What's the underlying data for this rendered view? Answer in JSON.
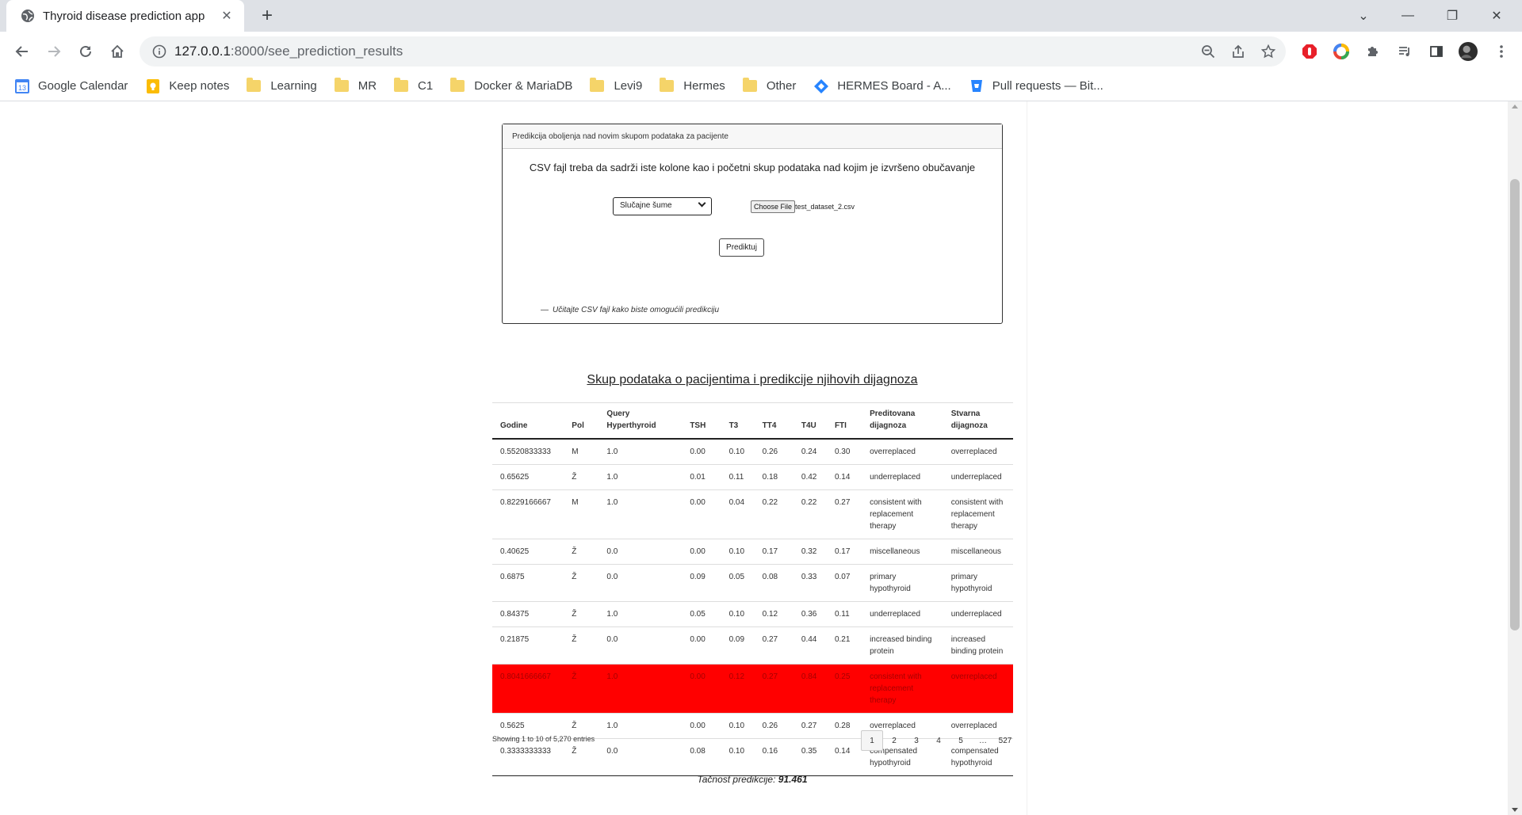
{
  "browser": {
    "tab_title": "Thyroid disease prediction app",
    "url_host": "127.0.0.1",
    "url_path": ":8000/see_prediction_results",
    "bookmarks": [
      {
        "label": "Google Calendar",
        "icon": "calendar-icon"
      },
      {
        "label": "Keep notes",
        "icon": "keep-icon"
      },
      {
        "label": "Learning",
        "icon": "folder-icon"
      },
      {
        "label": "MR",
        "icon": "folder-icon"
      },
      {
        "label": "C1",
        "icon": "folder-icon"
      },
      {
        "label": "Docker & MariaDB",
        "icon": "folder-icon"
      },
      {
        "label": "Levi9",
        "icon": "folder-icon"
      },
      {
        "label": "Hermes",
        "icon": "folder-icon"
      },
      {
        "label": "Other",
        "icon": "folder-icon"
      },
      {
        "label": "HERMES Board - A...",
        "icon": "diamond-icon"
      },
      {
        "label": "Pull requests — Bit...",
        "icon": "shield-icon"
      }
    ]
  },
  "upload_card": {
    "header": "Predikcija obolјenja nad novim skupom podataka za pacijente",
    "description": "CSV fajl treba da sadrži iste kolone kao i početni skup podataka nad kojim je izvršeno obučavanje",
    "model_select": "Slučajne šume",
    "file_button": "Choose File",
    "file_name": "test_dataset_2.csv",
    "predict_button": "Prediktuj",
    "hint_dash": "—",
    "hint": "Učitajte CSV fajl kako biste omogućili predikciju"
  },
  "results": {
    "title": "Skup podataka o pacijentima i predikcije njihovih dijagnoza",
    "columns": [
      "Godine",
      "Pol",
      "Query Hyperthyroid",
      "TSH",
      "T3",
      "TT4",
      "T4U",
      "FTI",
      "Preditovana dijagnoza",
      "Stvarna dijagnoza"
    ],
    "rows": [
      {
        "godine": "0.5520833333",
        "pol": "M",
        "query": "1.0",
        "tsh": "0.00",
        "t3": "0.10",
        "tt4": "0.26",
        "t4u": "0.24",
        "fti": "0.30",
        "pred": "overreplaced",
        "actual": "overreplaced",
        "mismatch": false
      },
      {
        "godine": "0.65625",
        "pol": "Ž",
        "query": "1.0",
        "tsh": "0.01",
        "t3": "0.11",
        "tt4": "0.18",
        "t4u": "0.42",
        "fti": "0.14",
        "pred": "underreplaced",
        "actual": "underreplaced",
        "mismatch": false
      },
      {
        "godine": "0.8229166667",
        "pol": "M",
        "query": "1.0",
        "tsh": "0.00",
        "t3": "0.04",
        "tt4": "0.22",
        "t4u": "0.22",
        "fti": "0.27",
        "pred": "consistent with replacement therapy",
        "actual": "consistent with replacement therapy",
        "mismatch": false
      },
      {
        "godine": "0.40625",
        "pol": "Ž",
        "query": "0.0",
        "tsh": "0.00",
        "t3": "0.10",
        "tt4": "0.17",
        "t4u": "0.32",
        "fti": "0.17",
        "pred": "miscellaneous",
        "actual": "miscellaneous",
        "mismatch": false
      },
      {
        "godine": "0.6875",
        "pol": "Ž",
        "query": "0.0",
        "tsh": "0.09",
        "t3": "0.05",
        "tt4": "0.08",
        "t4u": "0.33",
        "fti": "0.07",
        "pred": "primary hypothyroid",
        "actual": "primary hypothyroid",
        "mismatch": false
      },
      {
        "godine": "0.84375",
        "pol": "Ž",
        "query": "1.0",
        "tsh": "0.05",
        "t3": "0.10",
        "tt4": "0.12",
        "t4u": "0.36",
        "fti": "0.11",
        "pred": "underreplaced",
        "actual": "underreplaced",
        "mismatch": false
      },
      {
        "godine": "0.21875",
        "pol": "Ž",
        "query": "0.0",
        "tsh": "0.00",
        "t3": "0.09",
        "tt4": "0.27",
        "t4u": "0.44",
        "fti": "0.21",
        "pred": "increased binding protein",
        "actual": "increased binding protein",
        "mismatch": false
      },
      {
        "godine": "0.8041666667",
        "pol": "Ž",
        "query": "1.0",
        "tsh": "0.00",
        "t3": "0.12",
        "tt4": "0.27",
        "t4u": "0.84",
        "fti": "0.25",
        "pred": "consistent with replacement therapy",
        "actual": "overreplaced",
        "mismatch": true
      },
      {
        "godine": "0.5625",
        "pol": "Ž",
        "query": "1.0",
        "tsh": "0.00",
        "t3": "0.10",
        "tt4": "0.26",
        "t4u": "0.27",
        "fti": "0.28",
        "pred": "overreplaced",
        "actual": "overreplaced",
        "mismatch": false
      },
      {
        "godine": "0.3333333333",
        "pol": "Ž",
        "query": "0.0",
        "tsh": "0.08",
        "t3": "0.10",
        "tt4": "0.16",
        "t4u": "0.35",
        "fti": "0.14",
        "pred": "compensated hypothyroid",
        "actual": "compensated hypothyroid",
        "mismatch": false
      }
    ],
    "entries_info": "Showing 1 to 10 of 5,270 entries",
    "pages": [
      "1",
      "2",
      "3",
      "4",
      "5",
      "…",
      "527"
    ],
    "active_page": "1",
    "accuracy_label": "Tačnost predikcije:",
    "accuracy_value": "91.461"
  },
  "colors": {
    "mismatch_row": "#ff0000"
  }
}
